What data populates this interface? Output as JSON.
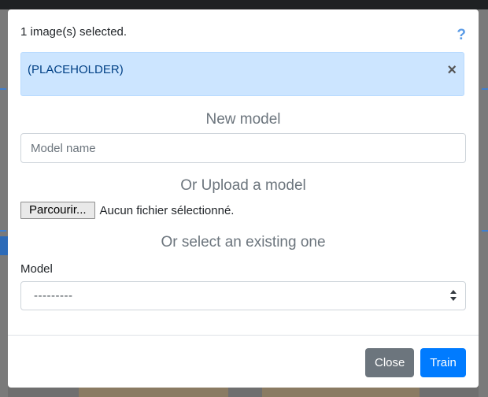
{
  "modal": {
    "header_text": "1 image(s) selected.",
    "help_icon": "question-mark-icon",
    "alert": {
      "text": "(PLACEHOLDER)",
      "close_glyph": "×"
    },
    "new_model": {
      "title": "New model",
      "placeholder": "Model name"
    },
    "upload": {
      "title": "Or Upload a model",
      "browse_label": "Parcourir...",
      "file_status": "Aucun fichier sélectionné."
    },
    "existing": {
      "title": "Or select an existing one",
      "label": "Model",
      "selected": "---------"
    },
    "footer": {
      "close_label": "Close",
      "train_label": "Train"
    }
  },
  "colors": {
    "primary": "#007bff",
    "secondary": "#6c757d",
    "alert_bg": "#cce5ff",
    "alert_text": "#004085"
  }
}
